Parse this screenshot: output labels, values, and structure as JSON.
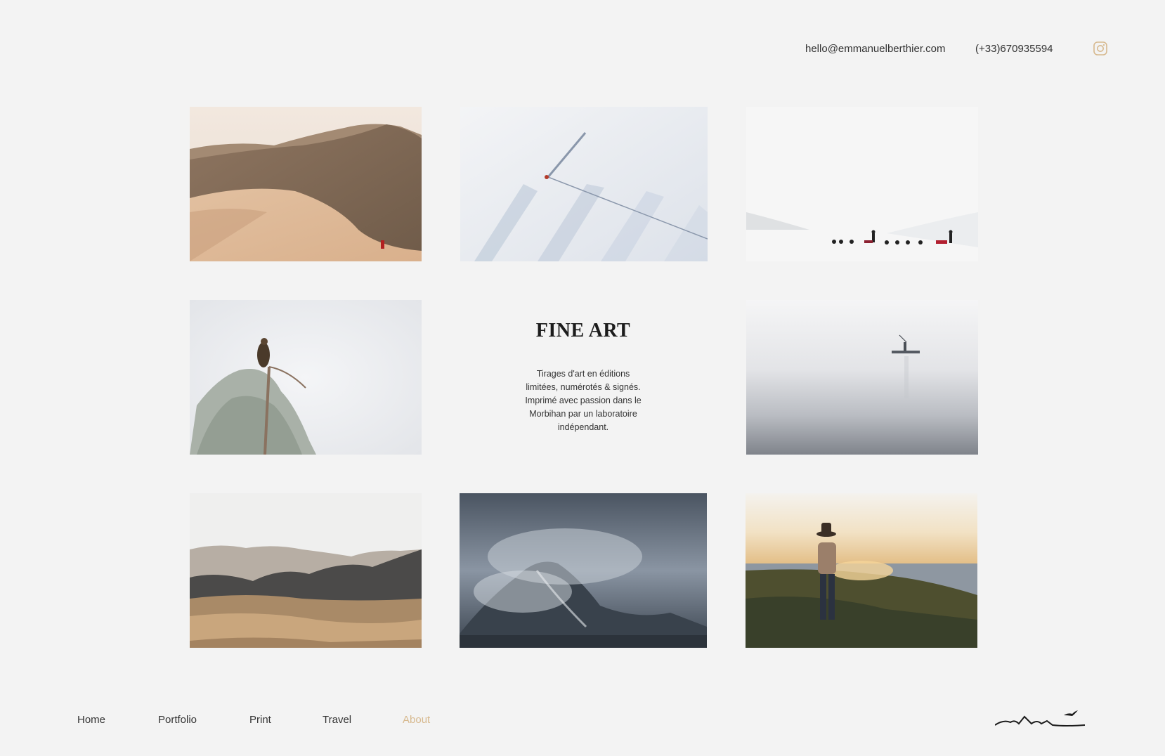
{
  "header": {
    "email": "hello@emmanuelberthier.com",
    "phone": "(+33)670935594",
    "instagram_icon": "instagram-icon",
    "accent_color": "#d7b98e"
  },
  "gallery": {
    "photos": [
      {
        "icon": "desert-dunes-photo"
      },
      {
        "icon": "snow-skier-aerial-photo"
      },
      {
        "icon": "dog-sled-snow-photo"
      },
      {
        "icon": "eagle-on-tree-photo"
      },
      {
        "icon": "misty-boat-photo"
      },
      {
        "icon": "desert-mountains-photo"
      },
      {
        "icon": "stormy-mountain-photo"
      },
      {
        "icon": "woman-sunset-coast-photo"
      }
    ]
  },
  "feature": {
    "title": "FINE ART",
    "description": "Tirages d'art en éditions limitées, numérotés & signés. Imprimé avec passion dans le Morbihan par un laboratoire indépendant."
  },
  "nav": {
    "items": [
      {
        "label": "Home"
      },
      {
        "label": "Portfolio"
      },
      {
        "label": "Print"
      },
      {
        "label": "Travel"
      },
      {
        "label": "About",
        "active": true
      }
    ]
  },
  "footer": {
    "logo_icon": "mountain-bird-logo-icon"
  }
}
